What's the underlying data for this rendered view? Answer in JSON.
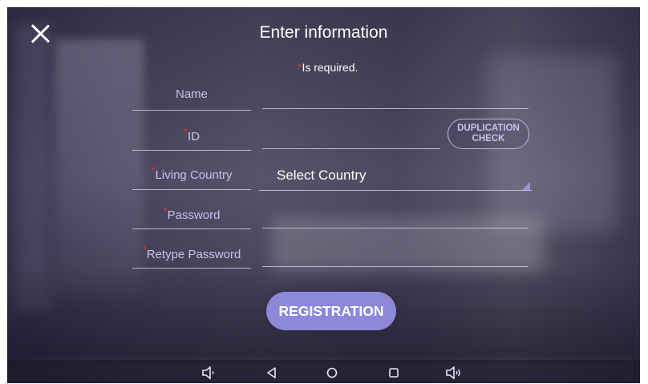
{
  "header": {
    "title": "Enter information",
    "required_marker": "*",
    "required_note": "Is required."
  },
  "form": {
    "name_label": "Name",
    "id_label": "ID",
    "country_label": "Living Country",
    "password_label": "Password",
    "retype_label": "Retype Password",
    "duplication_line1": "DUPLICATION",
    "duplication_line2": "CHECK",
    "country_selected": "Select Country",
    "register_label": "REGISTRATION"
  },
  "navbar": {
    "volume_down_icon": "volume-down-icon",
    "back_icon": "back-icon",
    "home_icon": "home-icon",
    "recents_icon": "recents-icon",
    "volume_up_icon": "volume-up-icon"
  },
  "colors": {
    "accent": "#8e88da",
    "label": "#c9c2ee",
    "required": "#e8332e"
  }
}
